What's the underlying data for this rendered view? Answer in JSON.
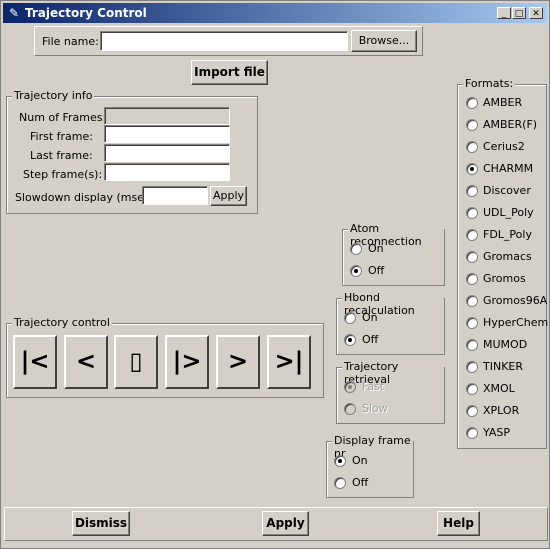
{
  "window": {
    "title": "Trajectory Control",
    "icon": "feather-icon",
    "controls": {
      "minimize": "_",
      "maximize": "□",
      "close": "✕"
    }
  },
  "file": {
    "label": "File name:",
    "value": "",
    "browse_label": "Browse...",
    "import_label": "Import file"
  },
  "traj_info": {
    "title": "Trajectory info",
    "num_frames_label": "Num of Frames:",
    "first_frame_label": "First frame:",
    "last_frame_label": "Last frame:",
    "step_label": "Step frame(s):",
    "slowdown_label": "Slowdown display (msec):",
    "apply_label": "Apply",
    "values": {
      "num_frames": "",
      "first": "",
      "last": "",
      "step": "",
      "slowdown": ""
    }
  },
  "traj_control": {
    "title": "Trajectory control",
    "buttons": [
      "|<",
      "<",
      "▯",
      "|>",
      ">",
      ">|"
    ]
  },
  "atom_reconnection": {
    "title": "Atom reconnection",
    "on": "On",
    "off": "Off",
    "selected": "Off"
  },
  "hbond": {
    "title": "Hbond recalculation",
    "on": "On",
    "off": "Off",
    "selected": "Off"
  },
  "retrieval": {
    "title": "Trajectory retrieval",
    "fast": "Fast",
    "slow": "Slow",
    "selected": "Fast",
    "disabled": true
  },
  "display_frame": {
    "title": "Display frame nr",
    "on": "On",
    "off": "Off",
    "selected": "On"
  },
  "formats": {
    "title": "Formats:",
    "items": [
      "AMBER",
      "AMBER(F)",
      "Cerius2",
      "CHARMM",
      "Discover",
      "UDL_Poly",
      "FDL_Poly",
      "Gromacs",
      "Gromos",
      "Gromos96A",
      "HyperChem",
      "MUMOD",
      "TINKER",
      "XMOL",
      "XPLOR",
      "YASP"
    ],
    "selected": "CHARMM"
  },
  "footer": {
    "dismiss": "Dismiss",
    "apply": "Apply",
    "help": "Help"
  }
}
